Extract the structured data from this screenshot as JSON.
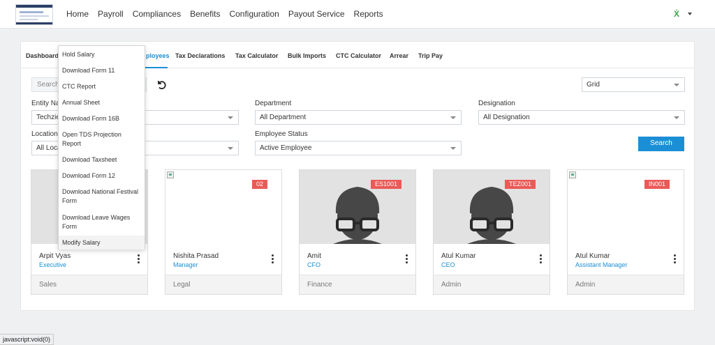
{
  "nav": {
    "menu": [
      "Home",
      "Payroll",
      "Compliances",
      "Benefits",
      "Configuration",
      "Payout Service",
      "Reports"
    ],
    "user_initial": "Ẋ"
  },
  "tabs": [
    {
      "label": "Dashboard"
    },
    {
      "label": "ployees",
      "active": true
    },
    {
      "label": "Tax Declarations"
    },
    {
      "label": "Tax Calculator"
    },
    {
      "label": "Bulk Imports"
    },
    {
      "label": "CTC Calculator"
    },
    {
      "label": "Arrear"
    },
    {
      "label": "Trip Pay"
    }
  ],
  "filters": {
    "search_placeholder": "Search",
    "view_mode": "Grid",
    "entity_label": "Entity Na",
    "entity_value": "Techzie",
    "department_label": "Department",
    "department_value": "All Department",
    "designation_label": "Designation",
    "designation_value": "All Designation",
    "location_label": "Location",
    "location_value": "All Loca",
    "status_label": "Employee Status",
    "status_value": "Active Employee",
    "search_button": "Search"
  },
  "dropdown": {
    "items": [
      "Hold Salary",
      "Download Form 11",
      "CTC Report",
      "Annual Sheet",
      "Download Form 16B",
      "Open TDS Projection Report",
      "Download Taxsheet",
      "Download Form 12",
      "Download National Festival Form",
      "Download Leave Wages Form",
      "Modify Salary"
    ]
  },
  "employees": [
    {
      "code": "",
      "name": "Arpit Vyas",
      "role": "Executive",
      "department": "Sales",
      "photo": "avatar"
    },
    {
      "code": "02",
      "name": "Nishita Prasad",
      "role": "Manager",
      "department": "Legal",
      "photo": "broken"
    },
    {
      "code": "ES1001",
      "name": "Amit",
      "role": "CFO",
      "department": "Finance",
      "photo": "avatar"
    },
    {
      "code": "TEZ001",
      "name": "Atul Kumar",
      "role": "CEO",
      "department": "Admin",
      "photo": "avatar"
    },
    {
      "code": "IN001",
      "name": "Atul Kumar",
      "role": "Assistant Manager",
      "department": "Admin",
      "photo": "broken"
    }
  ],
  "statusbar": "javascript:void(0)",
  "colors": {
    "accent": "#1a8fd6",
    "badge": "#ea5a57"
  }
}
